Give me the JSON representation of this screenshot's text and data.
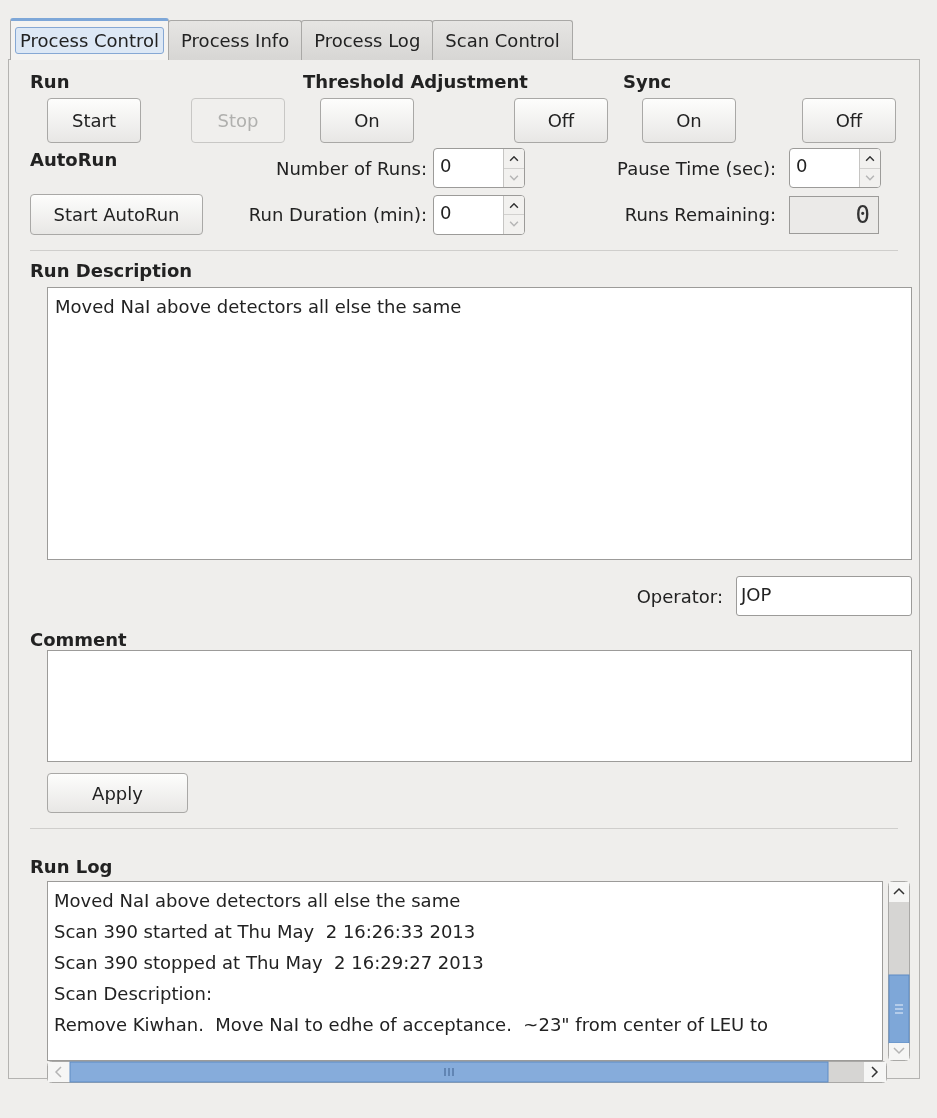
{
  "tabs": [
    {
      "label": "Process Control",
      "selected": true
    },
    {
      "label": "Process Info",
      "selected": false
    },
    {
      "label": "Process Log",
      "selected": false
    },
    {
      "label": "Scan Control",
      "selected": false
    }
  ],
  "sections": [
    {
      "title": "Run",
      "buttons": [
        {
          "label": "Start",
          "disabled": false
        },
        {
          "label": "Stop",
          "disabled": true
        }
      ]
    },
    {
      "title": "Threshold Adjustment",
      "buttons": [
        {
          "label": "On",
          "disabled": false
        },
        {
          "label": "Off",
          "disabled": false
        }
      ]
    },
    {
      "title": "Sync",
      "buttons": [
        {
          "label": "On",
          "disabled": false
        },
        {
          "label": "Off",
          "disabled": false
        }
      ]
    }
  ],
  "autorun": {
    "title": "AutoRun",
    "button": "Start AutoRun",
    "number_of_runs": {
      "label": "Number of Runs:",
      "value": "0"
    },
    "run_duration": {
      "label": "Run Duration (min):",
      "value": "0"
    },
    "pause_time": {
      "label": "Pause Time (sec):",
      "value": "0"
    },
    "runs_remaining": {
      "label": "Runs Remaining:",
      "value": "0"
    }
  },
  "run_description": {
    "title": "Run Description",
    "value": "Moved NaI above detectors all else the same"
  },
  "operator": {
    "label": "Operator:",
    "value": "JOP"
  },
  "comment": {
    "title": "Comment"
  },
  "apply_button": "Apply",
  "run_log": {
    "title": "Run Log",
    "lines": [
      "Moved NaI above detectors all else the same",
      "Scan 390 started at Thu May  2 16:26:33 2013",
      "Scan 390 stopped at Thu May  2 16:29:27 2013",
      "Scan Description:",
      "Remove Kiwhan.  Move NaI to edhe of acceptance.  ~23\" from center of LEU to"
    ]
  }
}
